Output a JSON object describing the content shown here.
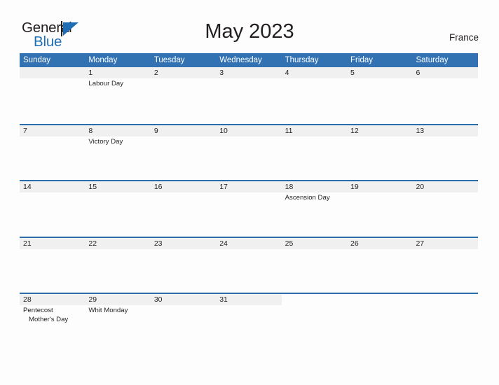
{
  "brand": {
    "name_dark": "General",
    "name_blue": "Blue",
    "accent_color": "#1f6eb5"
  },
  "header": {
    "title": "May 2023",
    "country": "France"
  },
  "calendar": {
    "header_bg": "#3272b3",
    "header_text_color": "#ffffff",
    "date_band_bg": "#f0f0f0",
    "rule_color": "#2b6cab",
    "weekdays": [
      "Sunday",
      "Monday",
      "Tuesday",
      "Wednesday",
      "Thursday",
      "Friday",
      "Saturday"
    ],
    "weeks": [
      [
        {
          "date": "",
          "events": []
        },
        {
          "date": "1",
          "events": [
            "Labour Day"
          ]
        },
        {
          "date": "2",
          "events": []
        },
        {
          "date": "3",
          "events": []
        },
        {
          "date": "4",
          "events": []
        },
        {
          "date": "5",
          "events": []
        },
        {
          "date": "6",
          "events": []
        }
      ],
      [
        {
          "date": "7",
          "events": []
        },
        {
          "date": "8",
          "events": [
            "Victory Day"
          ]
        },
        {
          "date": "9",
          "events": []
        },
        {
          "date": "10",
          "events": []
        },
        {
          "date": "11",
          "events": []
        },
        {
          "date": "12",
          "events": []
        },
        {
          "date": "13",
          "events": []
        }
      ],
      [
        {
          "date": "14",
          "events": []
        },
        {
          "date": "15",
          "events": []
        },
        {
          "date": "16",
          "events": []
        },
        {
          "date": "17",
          "events": []
        },
        {
          "date": "18",
          "events": [
            "Ascension Day"
          ]
        },
        {
          "date": "19",
          "events": []
        },
        {
          "date": "20",
          "events": []
        }
      ],
      [
        {
          "date": "21",
          "events": []
        },
        {
          "date": "22",
          "events": []
        },
        {
          "date": "23",
          "events": []
        },
        {
          "date": "24",
          "events": []
        },
        {
          "date": "25",
          "events": []
        },
        {
          "date": "26",
          "events": []
        },
        {
          "date": "27",
          "events": []
        }
      ],
      [
        {
          "date": "28",
          "events": [
            "Pentecost",
            "Mother's Day"
          ]
        },
        {
          "date": "29",
          "events": [
            "Whit Monday"
          ]
        },
        {
          "date": "30",
          "events": []
        },
        {
          "date": "31",
          "events": []
        },
        {
          "date": "",
          "events": []
        },
        {
          "date": "",
          "events": []
        },
        {
          "date": "",
          "events": []
        }
      ]
    ]
  }
}
